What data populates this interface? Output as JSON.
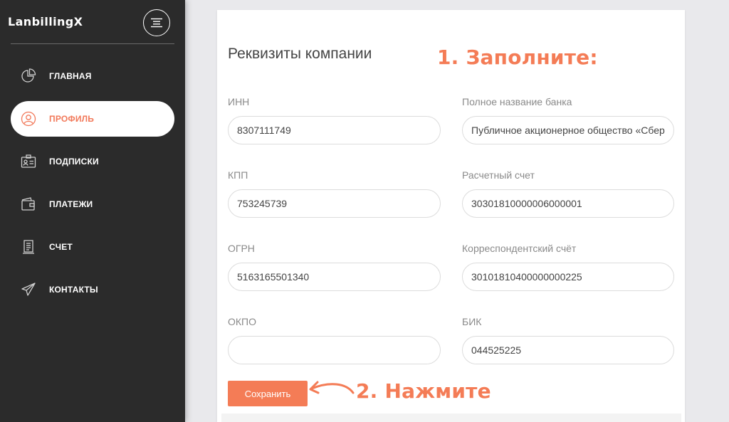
{
  "app": {
    "brand": "LanbillingX"
  },
  "icons": {
    "menu": "menu-lines-icon"
  },
  "colors": {
    "accent": "#f47c56",
    "sidebar": "#2b2b2b",
    "background": "#e9e9ec"
  },
  "nav": [
    {
      "label": "ГЛАВНАЯ",
      "icon": "pie-chart-icon",
      "active": false
    },
    {
      "label": "ПРОФИЛЬ",
      "icon": "user-circle-icon",
      "active": true
    },
    {
      "label": "ПОДПИСКИ",
      "icon": "id-card-icon",
      "active": false
    },
    {
      "label": "ПЛАТЕЖИ",
      "icon": "wallet-icon",
      "active": false
    },
    {
      "label": "СЧЕТ",
      "icon": "receipt-icon",
      "active": false
    },
    {
      "label": "КОНТАКТЫ",
      "icon": "paper-plane-icon",
      "active": false
    }
  ],
  "form": {
    "title": "Реквизиты компании",
    "fields": {
      "inn": {
        "label": "ИНН",
        "value": "8307111749"
      },
      "bank_name": {
        "label": "Полное название банка",
        "value": "Публичное акционерное общество «Сбербанк России»"
      },
      "kpp": {
        "label": "КПП",
        "value": "753245739"
      },
      "account": {
        "label": "Расчетный счет",
        "value": "30301810000006000001"
      },
      "ogrn": {
        "label": "ОГРН",
        "value": "5163165501340"
      },
      "corr_account": {
        "label": "Корреспондентский счёт",
        "value": "30101810400000000225"
      },
      "okpo": {
        "label": "ОКПО",
        "value": ""
      },
      "bik": {
        "label": "БИК",
        "value": "044525225"
      }
    },
    "save_label": "Сохранить"
  },
  "annotations": {
    "step1": "1. Заполните:",
    "step2": "2. Нажмите"
  }
}
